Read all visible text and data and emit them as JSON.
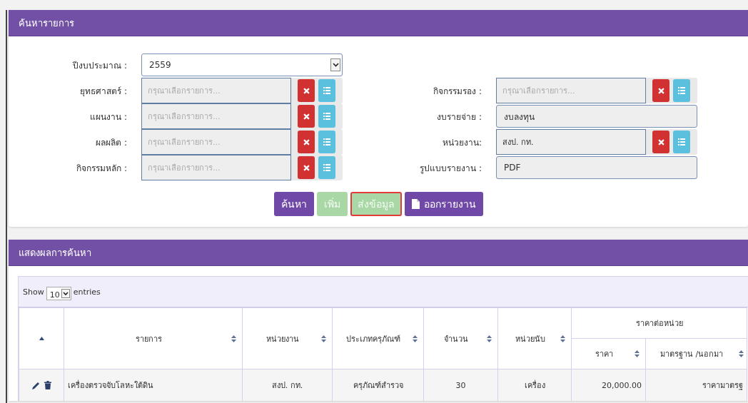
{
  "search_panel": {
    "title": "ค้นหารายการ",
    "fields_left": [
      {
        "kind": "select",
        "label": "ปีงบประมาณ :",
        "value": "2559"
      },
      {
        "kind": "picker",
        "label": "ยุทธศาสตร์ :",
        "placeholder": "กรุณาเลือกรายการ..."
      },
      {
        "kind": "picker",
        "label": "แผนงาน :",
        "placeholder": "กรุณาเลือกรายการ..."
      },
      {
        "kind": "picker",
        "label": "ผลผลิต :",
        "placeholder": "กรุณาเลือกรายการ..."
      },
      {
        "kind": "picker",
        "label": "กิจกรรมหลัก :",
        "placeholder": "กรุณาเลือกรายการ..."
      }
    ],
    "fields_right": [
      {
        "kind": "picker",
        "label": "กิจกรรมรอง :",
        "placeholder": "กรุณาเลือกรายการ..."
      },
      {
        "kind": "text",
        "label": "งบรายจ่าย :",
        "value": "งบลงทุน"
      },
      {
        "kind": "picker",
        "label": "หน่วยงาน:",
        "value": "สงป. กท."
      },
      {
        "kind": "text",
        "label": "รูปแบบรายงาน :",
        "value": "PDF"
      }
    ],
    "buttons": [
      {
        "kind": "plain",
        "label": "ค้นหา",
        "disabled": false,
        "focused": false
      },
      {
        "kind": "plain",
        "label": "เพิ่ม",
        "disabled": true,
        "focused": false
      },
      {
        "kind": "plain",
        "label": "ส่งข้อมูล",
        "disabled": true,
        "focused": true
      },
      {
        "kind": "document",
        "label": "ออกรายงาน",
        "disabled": false,
        "focused": false
      }
    ]
  },
  "results": {
    "title": "แสดงผลการค้นหา",
    "length": {
      "before": "Show",
      "value": "10",
      "after": "entries"
    },
    "table": {
      "columns": [
        {
          "sorted": true
        },
        {
          "label": "รายการ",
          "sorted": false
        },
        {
          "label": "หน่วยงาน",
          "sorted": false
        },
        {
          "label": "ประเภทครุภัณฑ์",
          "sorted": false
        },
        {
          "label": "จำนวน",
          "sorted": false
        },
        {
          "label": "หน่วยนับ",
          "sorted": false
        },
        {
          "label": "ราคาต่อหน่วย",
          "colspan": 2,
          "children": [
            {
              "label": "ราคา",
              "sorted": false
            },
            {
              "label": "มาตรฐาน /นอกมา",
              "sorted": false
            }
          ]
        }
      ],
      "rows": [
        {
          "cells": [
            "",
            "เครื่องตรวจจับโลหะใต้ดิน",
            "สงป. กท.",
            "ครุภัณฑ์สำรวจ",
            "30",
            "เครื่อง",
            "20,000.00",
            "ราคามาตรฐ"
          ]
        }
      ]
    }
  }
}
